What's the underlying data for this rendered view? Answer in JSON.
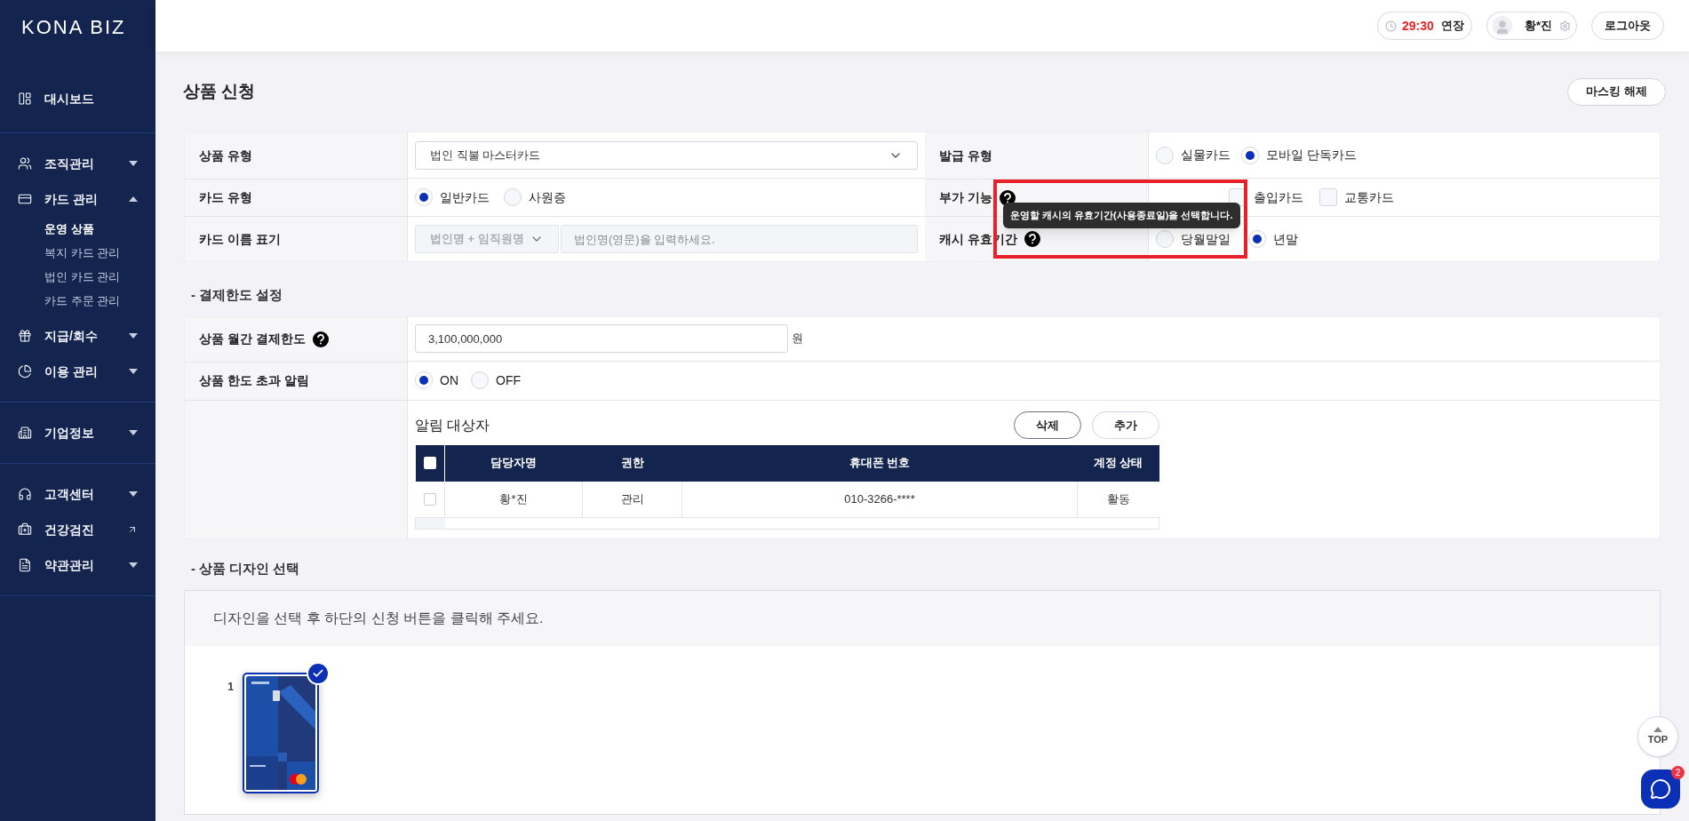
{
  "sidebar": {
    "logo": "KONA BIZ",
    "sections": [
      {
        "items": [
          {
            "label": "대시보드",
            "kind": "link"
          }
        ]
      },
      {
        "items": [
          {
            "label": "조직관리",
            "kind": "menu",
            "expanded": false
          },
          {
            "label": "카드 관리",
            "kind": "menu",
            "expanded": true,
            "children": [
              {
                "label": "운영 상품",
                "selected": true
              },
              {
                "label": "복지 카드 관리",
                "selected": false
              },
              {
                "label": "법인 카드 관리",
                "selected": false
              },
              {
                "label": "카드 주문 관리",
                "selected": false
              }
            ]
          },
          {
            "label": "지급/회수",
            "kind": "menu",
            "expanded": false
          },
          {
            "label": "이용 관리",
            "kind": "menu",
            "expanded": false
          }
        ]
      },
      {
        "items": [
          {
            "label": "기업정보",
            "kind": "menu",
            "expanded": false
          }
        ]
      },
      {
        "items": [
          {
            "label": "고객센터",
            "kind": "menu",
            "expanded": false
          },
          {
            "label": "건강검진",
            "kind": "external"
          },
          {
            "label": "약관관리",
            "kind": "menu",
            "expanded": false
          }
        ]
      }
    ]
  },
  "header": {
    "timer": "29:30",
    "extend": "연장",
    "user": "황*진",
    "logout": "로그아웃"
  },
  "page": {
    "title": "상품 신청",
    "mask_button": "마스킹 해제"
  },
  "product_form": {
    "product_type": {
      "label": "상품 유형",
      "value": "법인 직불 마스터카드"
    },
    "issue_type": {
      "label": "발급 유형",
      "options": [
        {
          "label": "실물카드",
          "selected": false
        },
        {
          "label": "모바일 단독카드",
          "selected": true
        }
      ]
    },
    "card_type": {
      "label": "카드 유형",
      "options": [
        {
          "label": "일반카드",
          "selected": true
        },
        {
          "label": "사원증",
          "selected": false
        }
      ]
    },
    "extra_features": {
      "label": "부가 기능",
      "options": [
        {
          "label": "출입카드",
          "checked": false
        },
        {
          "label": "교통카드",
          "checked": false
        }
      ]
    },
    "card_name": {
      "label": "카드 이름 표기",
      "select_placeholder": "법인명 + 임직원명",
      "input_placeholder": "법인명(영문)을 입력하세요."
    },
    "cash_validity": {
      "label": "캐시 유효기간",
      "options": [
        {
          "label": "당월말일",
          "selected": false
        },
        {
          "label": "년말",
          "selected": true
        }
      ]
    },
    "tooltip": "운영할 캐시의 유효기간(사용종료일)을 선택합니다."
  },
  "limit_section": {
    "title": "- 결제한도 설정",
    "monthly_limit": {
      "label": "상품 월간 결제한도",
      "value": "3,100,000,000",
      "unit": "원"
    },
    "alert": {
      "label": "상품 한도 초과 알림",
      "options": [
        {
          "label": "ON",
          "selected": true
        },
        {
          "label": "OFF",
          "selected": false
        }
      ]
    },
    "recipients": {
      "title": "알림 대상자",
      "buttons": [
        "삭제",
        "추가"
      ],
      "all_checked": false,
      "columns": [
        "담당자명",
        "권한",
        "휴대폰 번호",
        "계정 상태"
      ],
      "rows": [
        {
          "checked": false,
          "cells": [
            "황*진",
            "관리",
            "010-3266-****",
            "활동"
          ]
        }
      ]
    }
  },
  "design_section": {
    "title": "- 상품 디자인 선택",
    "instruction": "디자인을 선택 후 하단의 신청 버튼을 클릭해 주세요.",
    "designs": [
      {
        "number": "1",
        "selected": true
      }
    ]
  },
  "top_button": "TOP",
  "chat_badge": "2"
}
